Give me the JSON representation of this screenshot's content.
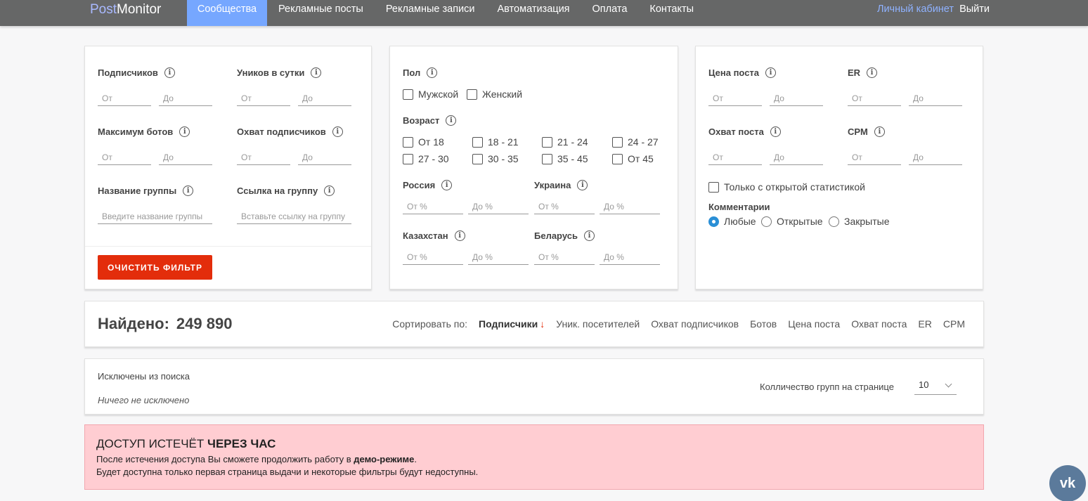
{
  "header": {
    "logo_a": "Post",
    "logo_b": "Monitor",
    "nav": [
      "Сообщества",
      "Рекламные посты",
      "Рекламные записи",
      "Автоматизация",
      "Оплата",
      "Контакты"
    ],
    "cabinet": "Личный кабинет",
    "logout": "Выйти"
  },
  "filters": {
    "left": {
      "subscribers": "Подписчиков",
      "uniques": "Уников в сутки",
      "max_bots": "Максимум ботов",
      "reach_subs": "Охват подписчиков",
      "group_name": "Название группы",
      "group_link": "Ссылка на группу",
      "from": "От",
      "to": "До",
      "group_name_ph": "Введите название группы",
      "group_link_ph": "Вставьте ссылку на группу",
      "clear": "ОЧИСТИТЬ ФИЛЬТР"
    },
    "middle": {
      "gender": "Пол",
      "male": "Мужской",
      "female": "Женский",
      "age": "Возраст",
      "ages": [
        "От 18",
        "18 - 21",
        "21 - 24",
        "24 - 27",
        "27 - 30",
        "30 - 35",
        "35 - 45",
        "От 45"
      ],
      "russia": "Россия",
      "ukraine": "Украина",
      "kazakhstan": "Казахстан",
      "belarus": "Беларусь",
      "from_pct": "От %",
      "to_pct": "До %"
    },
    "right": {
      "price": "Цена поста",
      "er": "ER",
      "reach_post": "Охват поста",
      "cpm": "CPM",
      "from": "От",
      "to": "До",
      "open_stats": "Только с открытой статистикой",
      "comments": "Комментарии",
      "any": "Любые",
      "open": "Открытые",
      "closed": "Закрытые"
    }
  },
  "results": {
    "found_label": "Найдено:",
    "found_count": "249 890",
    "sort_label": "Сортировать по:",
    "sort_active": "Подписчики",
    "sort_options": [
      "Уник. посетителей",
      "Охват подписчиков",
      "Ботов",
      "Цена поста",
      "Охват поста",
      "ER",
      "CPM"
    ]
  },
  "excluded": {
    "title": "Исключены из поиска",
    "none": "Ничего не исключено",
    "per_page_label": "Колличество групп на странице",
    "per_page_value": "10"
  },
  "alert": {
    "title_a": "ДОСТУП ИСТЕЧЁТ ",
    "title_b": "ЧЕРЕЗ ЧАС",
    "line1_a": "После истечения доступа Вы сможете продолжить работу в ",
    "line1_b": "демо-режиме",
    "line1_c": ".",
    "line2": "Будет доступна только первая страница выдачи и некоторые фильтры будут недоступны."
  },
  "vk": "vk"
}
